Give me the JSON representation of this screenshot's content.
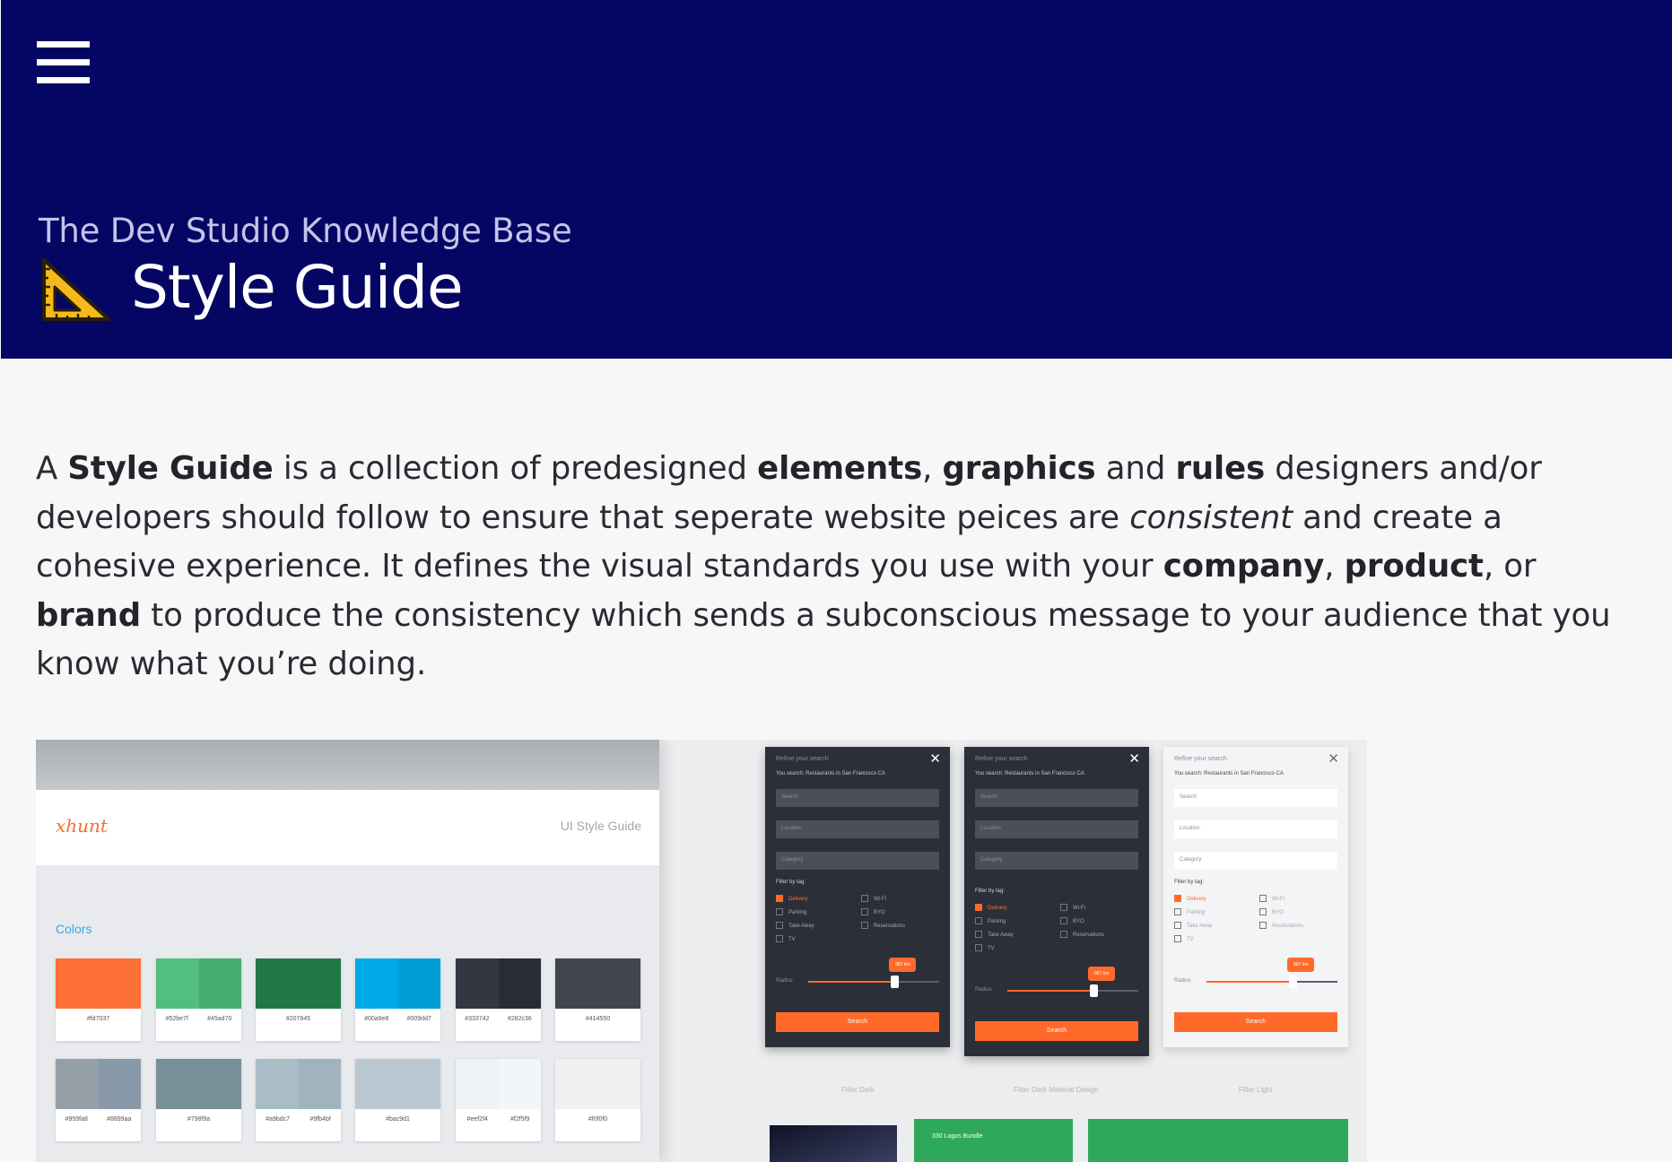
{
  "header": {
    "kb_title": "The Dev Studio Knowledge Base",
    "page_title": "Style Guide",
    "page_icon": "triangular-ruler-icon",
    "bg_color": "#050664"
  },
  "intro": {
    "t1": "A ",
    "b1": "Style Guide",
    "t2": " is a collection of predesigned ",
    "b2": "elements",
    "t3": ", ",
    "b3": "graphics",
    "t4": " and ",
    "b4": "rules",
    "t5": " designers and/or developers should follow to ensure that seperate website peices are ",
    "i1": "consistent",
    "t6": " and create a cohesive experience. It defines the visual standards you use with your ",
    "b5": "company",
    "t7": ", ",
    "b6": "product",
    "t8": ", or ",
    "b7": "brand",
    "t9": " to produce the consistency which sends a subconscious message to your audience that you know what you’re doing."
  },
  "preview": {
    "brand": "xhunt",
    "ui_label": "UI Style Guide",
    "colors_label": "Colors",
    "swatches": [
      {
        "colors": [
          "#fd7037"
        ],
        "hex": [
          "#fd7037"
        ]
      },
      {
        "colors": [
          "#52be7f",
          "#45ad70"
        ],
        "hex": [
          "#52be7f",
          "#45ad70"
        ]
      },
      {
        "colors": [
          "#207945"
        ],
        "hex": [
          "#207945"
        ]
      },
      {
        "colors": [
          "#00a9e8",
          "#009dd7"
        ],
        "hex": [
          "#00a9e8",
          "#009dd7"
        ]
      },
      {
        "colors": [
          "#333742",
          "#282c36"
        ],
        "hex": [
          "#333742",
          "#282c36"
        ]
      },
      {
        "colors": [
          "#414550"
        ],
        "hex": [
          "#414550"
        ]
      },
      {
        "colors": [
          "#959fa8",
          "#8899aa"
        ],
        "hex": [
          "#959fa8",
          "#8899aa"
        ]
      },
      {
        "colors": [
          "#798f9a"
        ],
        "hex": [
          "#798f9a"
        ]
      },
      {
        "colors": [
          "#a9bdc7",
          "#9fb4bf"
        ],
        "hex": [
          "#a9bdc7",
          "#9fb4bf"
        ]
      },
      {
        "colors": [
          "#bac9d1"
        ],
        "hex": [
          "#bac9d1"
        ]
      },
      {
        "colors": [
          "#eef2f4",
          "#f2f5f9"
        ],
        "hex": [
          "#eef2f4",
          "#f2f5f9"
        ]
      },
      {
        "colors": [
          "#f0f0f0"
        ],
        "hex": [
          "#f0f0f0"
        ]
      }
    ],
    "phone": {
      "title": "Refine your search",
      "sub": "You search: Restaurants in San Francisco CA",
      "search_placeholder": "Search",
      "location_placeholder": "Location",
      "category_placeholder": "Category",
      "filter_label": "Filter by tag:",
      "tags_left": [
        "Delivery",
        "Parking",
        "Take Away",
        "TV"
      ],
      "tags_right": [
        "Wi-Fi",
        "BYO",
        "Reservations"
      ],
      "radius_label": "Radius",
      "bubble": "887 km",
      "search_button": "Search",
      "close_glyph": "✕"
    },
    "captions": [
      "Filter Dark",
      "Filter Dark Material Design",
      "Filter Light"
    ],
    "bundle_label": "330 Logos Bundle"
  }
}
